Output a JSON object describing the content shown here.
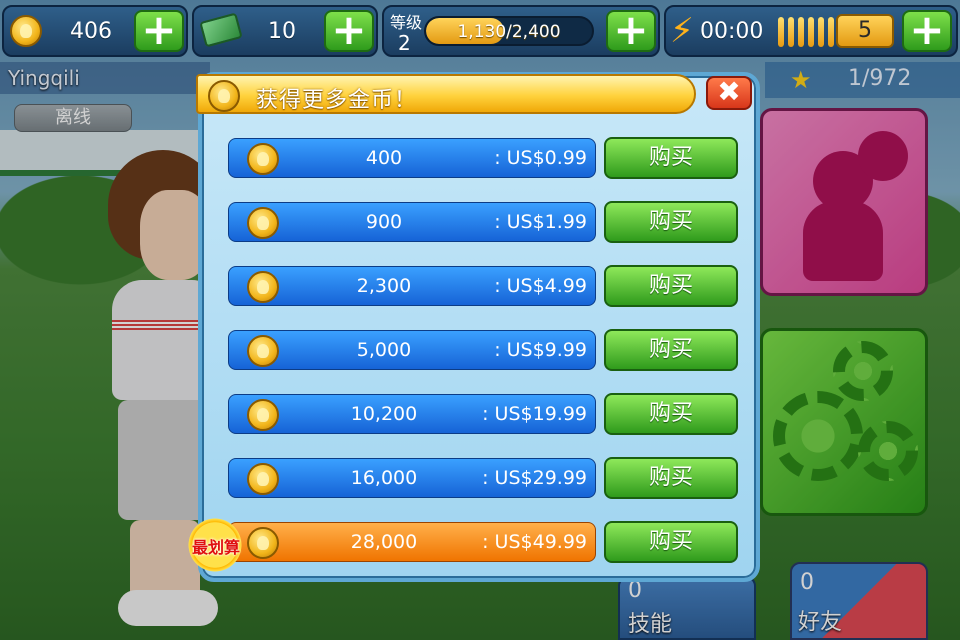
{
  "hud": {
    "coins": "406",
    "cash": "10",
    "level_label": "等级",
    "level": "2",
    "xp_text": "1,130/2,400",
    "xp_fraction": 0.47,
    "energy_time": "00:00",
    "energy_count": "5"
  },
  "player": {
    "name": "Yingqili",
    "status": "离线"
  },
  "side": {
    "progress": "1/972",
    "skills_count": "0",
    "skills_label": "技能",
    "friends_count": "0",
    "friends_label": "好友"
  },
  "modal": {
    "title": "获得更多金币！",
    "close_symbol": "✖",
    "buy_label": "购买",
    "best_deal_label": "最划算",
    "packages": [
      {
        "amount": "400",
        "price": ": US$0.99"
      },
      {
        "amount": "900",
        "price": ": US$1.99"
      },
      {
        "amount": "2,300",
        "price": ": US$4.99"
      },
      {
        "amount": "5,000",
        "price": ": US$9.99"
      },
      {
        "amount": "10,200",
        "price": ": US$19.99"
      },
      {
        "amount": "16,000",
        "price": ": US$29.99"
      },
      {
        "amount": "28,000",
        "price": ": US$49.99"
      }
    ]
  },
  "colors": {
    "row_blue": "#1e7ae6",
    "row_highlight": "#f58a12",
    "buy_green": "#3fae24",
    "header_gold": "#ffd23c"
  }
}
